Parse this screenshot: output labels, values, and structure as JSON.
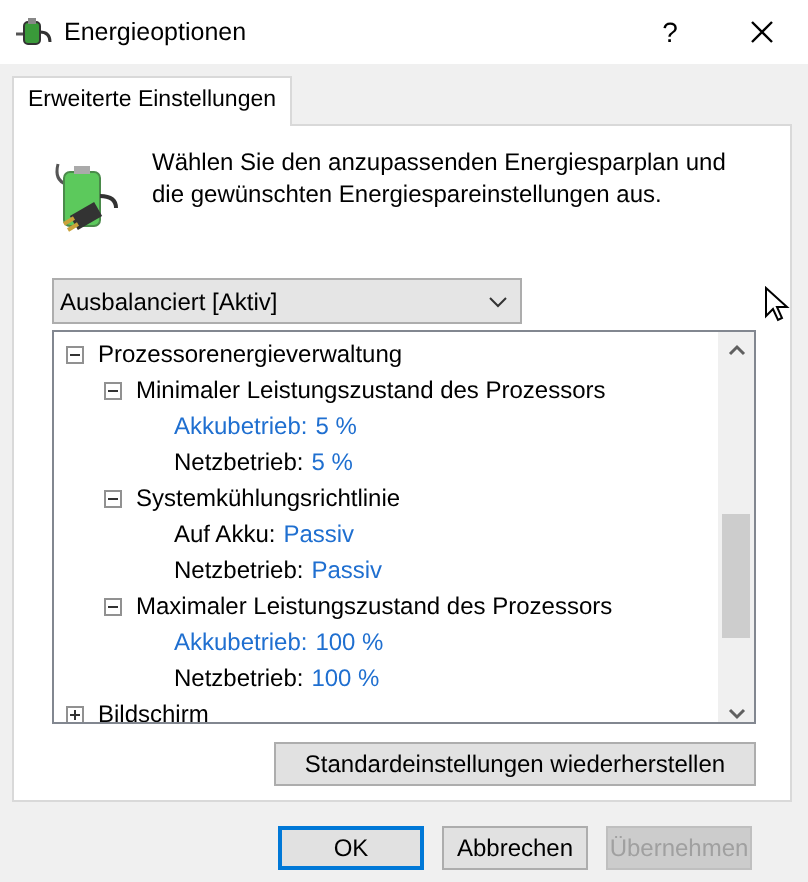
{
  "window": {
    "title": "Energieoptionen",
    "help": "?"
  },
  "tabs": [
    {
      "label": "Erweiterte Einstellungen",
      "selected": true
    }
  ],
  "description": "Wählen Sie den anzupassenden Energiesparplan und die gewünschten Energiespareinstellungen aus.",
  "plan_dropdown": {
    "value": "Ausbalanciert [Aktiv]"
  },
  "tree": [
    {
      "label": "Prozessorenergieverwaltung",
      "expanded": true,
      "children": [
        {
          "label": "Minimaler Leistungszustand des Prozessors",
          "expanded": true,
          "children": [
            {
              "label": "Akkubetrieb:",
              "value": "5 %",
              "highlighted": true
            },
            {
              "label": "Netzbetrieb:",
              "value": "5 %",
              "highlighted": false
            }
          ]
        },
        {
          "label": "Systemkühlungsrichtlinie",
          "expanded": true,
          "children": [
            {
              "label": "Auf Akku:",
              "value": "Passiv",
              "highlighted": false
            },
            {
              "label": "Netzbetrieb:",
              "value": "Passiv",
              "highlighted": false
            }
          ]
        },
        {
          "label": "Maximaler Leistungszustand des Prozessors",
          "expanded": true,
          "children": [
            {
              "label": "Akkubetrieb:",
              "value": "100 %",
              "highlighted": true
            },
            {
              "label": "Netzbetrieb:",
              "value": "100 %",
              "highlighted": false
            }
          ]
        }
      ]
    },
    {
      "label": "Bildschirm",
      "expanded": false
    }
  ],
  "restore_button": "Standardeinstellungen wiederherstellen",
  "buttons": [
    {
      "label": "OK",
      "default": true,
      "disabled": false
    },
    {
      "label": "Abbrechen",
      "default": false,
      "disabled": false
    },
    {
      "label": "Übernehmen",
      "default": false,
      "disabled": true
    }
  ]
}
